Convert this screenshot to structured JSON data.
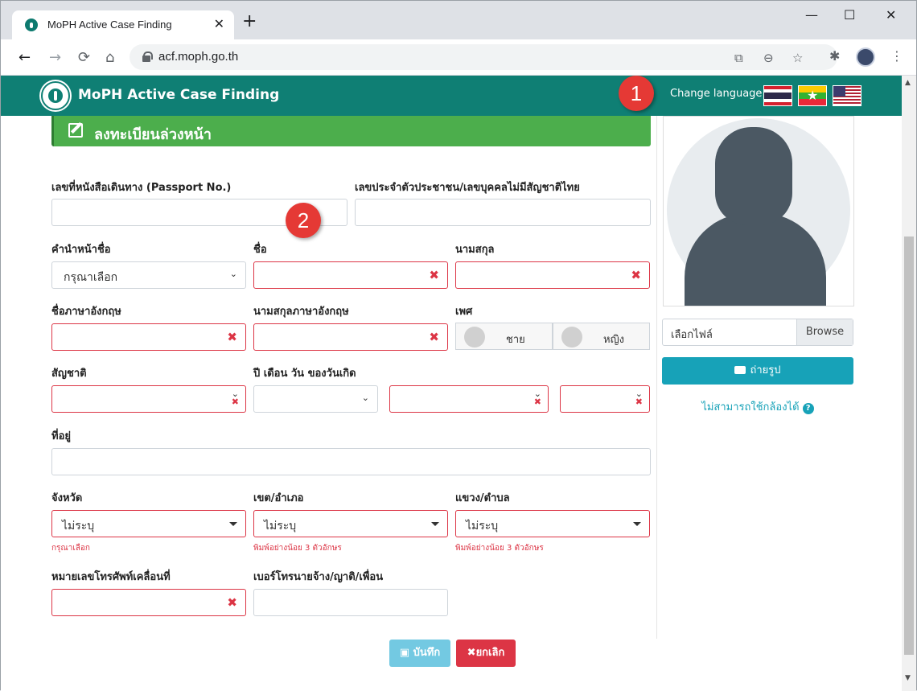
{
  "browser": {
    "tab_title": "MoPH Active Case Finding",
    "tab_close": "✕",
    "new_tab": "+",
    "url": "acf.moph.go.th",
    "window_min": "—",
    "window_max": "☐",
    "window_close": "✕"
  },
  "header": {
    "brand": "MoPH Active Case Finding",
    "change_language": "Change language"
  },
  "callouts": [
    "1",
    "2"
  ],
  "form": {
    "banner_title": "ลงทะเบียนล่วงหน้า",
    "passport_label": "เลขที่หนังสือเดินทาง (Passport No.)",
    "citizen_id_label": "เลขประจำตัวประชาชน/เลขบุคคลไม่มีสัญชาติไทย",
    "prefix_label": "คำนำหน้าชื่อ",
    "prefix_value": "กรุณาเลือก",
    "firstname_label": "ชื่อ",
    "lastname_label": "นามสกุล",
    "firstname_en_label": "ชื่อภาษาอังกฤษ",
    "lastname_en_label": "นามสกุลภาษาอังกฤษ",
    "gender_label": "เพศ",
    "gender_male": "ชาย",
    "gender_female": "หญิง",
    "nationality_label": "สัญชาติ",
    "dob_label": "ปี เดือน วัน ของวันเกิด",
    "address_label": "ที่อยู่",
    "province_label": "จังหวัด",
    "district_label": "เขต/อำเภอ",
    "subdistrict_label": "แขวง/ตำบล",
    "province_value": "ไม่ระบุ",
    "district_value": "ไม่ระบุ",
    "subdistrict_value": "ไม่ระบุ",
    "province_hint": "กรุณาเลือก",
    "district_hint": "พิมพ์อย่างน้อย 3 ตัวอักษร",
    "subdistrict_hint": "พิมพ์อย่างน้อย 3 ตัวอักษร",
    "mobile_label": "หมายเลขโทรศัพท์เคลื่อนที่",
    "contact_phone_label": "เบอร์โทรนายจ้าง/ญาติ/เพื่อน",
    "error_mark": "✖",
    "save": "บันทึก",
    "cancel": "ยกเลิก"
  },
  "sidebar": {
    "choose_file": "เลือกไฟล์",
    "browse": "Browse",
    "take_photo": "ถ่ายรูป",
    "no_camera": "ไม่สามารถใช้กล้องได้"
  },
  "colors": {
    "header": "#0f7f74",
    "banner": "#4cae4c",
    "info": "#17a2b8",
    "danger": "#dc3545"
  }
}
